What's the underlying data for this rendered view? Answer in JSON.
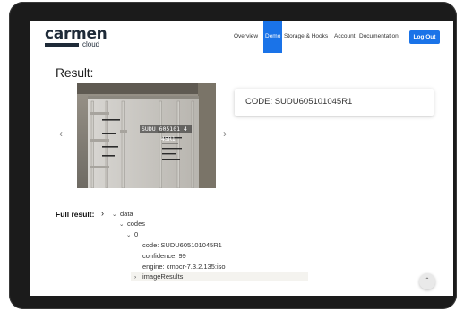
{
  "header": {
    "logo_main": "carmen",
    "logo_sub": "cloud",
    "nav": [
      "Overview",
      "Demo",
      "Storage & Hooks",
      "Account",
      "Documentation"
    ],
    "active_nav": "Demo",
    "logout_label": "Log Out",
    "accent_color": "#1a73e8"
  },
  "main": {
    "title": "Result:",
    "carousel_prev_icon": "chevron-left-icon",
    "carousel_next_icon": "chevron-right-icon",
    "photo_overlay_text": "SUDU 605101 4 45R1",
    "code_card_text": "CODE: SUDU605101045R1"
  },
  "full_result": {
    "label": "Full result:",
    "tree": {
      "data": "data",
      "codes": "codes",
      "index": "0",
      "code": "code: SUDU605101045R1",
      "confidence": "confidence: 99",
      "engine": "engine: cmocr-7.3.2.135:iso",
      "image_results": "imageResults"
    }
  },
  "scroll_top_icon": "chevron-up-icon"
}
